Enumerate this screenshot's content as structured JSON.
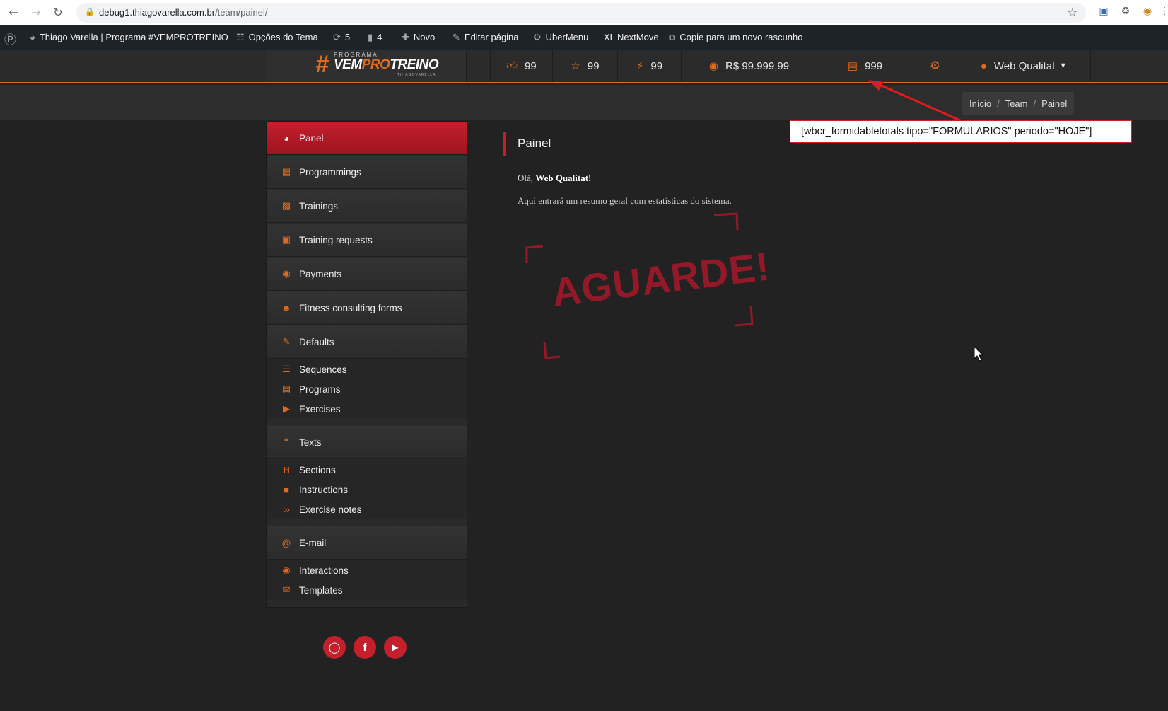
{
  "browser": {
    "url_host": "debug1.thiagovarella.com.br",
    "url_path": "/team/painel/"
  },
  "wp_admin_bar": {
    "site_name": "Thiago Varella | Programa #VEMPROTREINO",
    "theme_options": "Opções do Tema",
    "updates_count": "5",
    "comments_count": "4",
    "new_label": "Novo",
    "edit_page": "Editar página",
    "ubermenu": "UberMenu",
    "xl_nextmove": "XL NextMove",
    "copy_draft": "Copie para um novo rascunho"
  },
  "logo": {
    "hash": "#",
    "top": "PROGRAMA",
    "main_a": "VEM",
    "main_b": "PRO",
    "main_c": "TREINO",
    "sub": "THIAGOVARELLA"
  },
  "stats": {
    "likes": "99",
    "stars": "99",
    "bolts": "99",
    "money": "R$ 99.999,99",
    "forms": "999"
  },
  "user": {
    "name": "Web Qualitat"
  },
  "breadcrumb": {
    "home": "Início",
    "team": "Team",
    "current": "Painel"
  },
  "annotation": {
    "text": "[wbcr_formidabletotals tipo=\"FORMULARIOS\" periodo=\"HOJE\"]"
  },
  "sidebar": {
    "panel": "Panel",
    "programmings": "Programmings",
    "trainings": "Trainings",
    "training_requests": "Training requests",
    "payments": "Payments",
    "fitness_forms": "Fitness consulting forms",
    "defaults": "Defaults",
    "sequences": "Sequences",
    "programs": "Programs",
    "exercises": "Exercises",
    "texts": "Texts",
    "sections": "Sections",
    "instructions": "Instructions",
    "exercise_notes": "Exercise notes",
    "email": "E-mail",
    "interactions": "Interactions",
    "templates": "Templates"
  },
  "content": {
    "title": "Painel",
    "hello_prefix": "Olá, ",
    "hello_name": "Web Qualitat!",
    "description": "Aqui entrará um resumo geral com estatísticas do sistema.",
    "stamp": "AGUARDE!"
  },
  "colors": {
    "accent": "#e26b1b",
    "brand_red": "#c4202c",
    "background": "#222222"
  }
}
